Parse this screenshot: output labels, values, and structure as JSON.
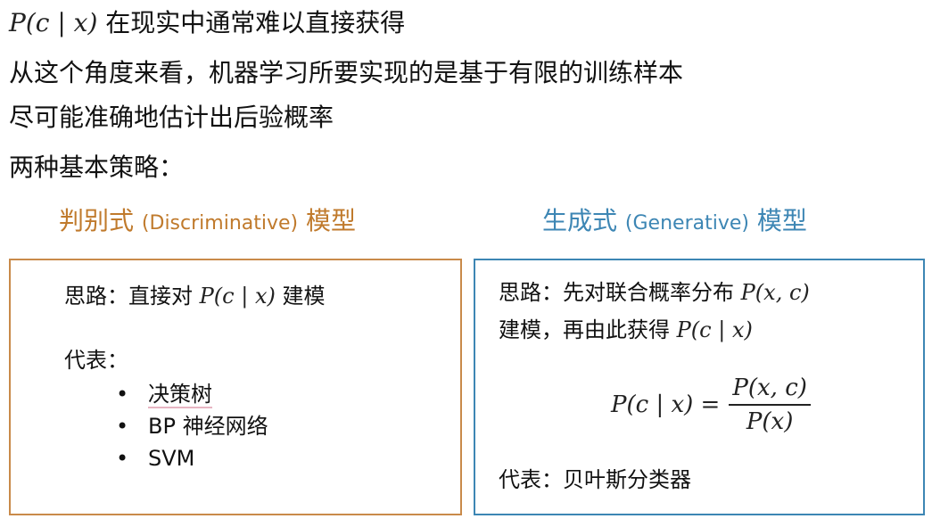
{
  "line1": {
    "math": "P(c | x)",
    "text": " 在现实中通常难以直接获得"
  },
  "line2": "从这个角度来看，机器学习所要实现的是基于有限的训练样本",
  "line3": "尽可能准确地估计出后验概率",
  "line4": "两种基本策略：",
  "left": {
    "heading_cn1": "判别式",
    "heading_en": "(Discriminative)",
    "heading_cn2": "模型",
    "idea_label": "思路：直接对",
    "idea_math": "P(c | x)",
    "idea_tail": "建模",
    "rep_label": "代表：",
    "examples": [
      "决策树",
      "BP 神经网络",
      "SVM"
    ]
  },
  "right": {
    "heading_cn1": "生成式",
    "heading_en": "(Generative)",
    "heading_cn2": "模型",
    "idea_line1": "思路：先对联合概率分布",
    "idea_math1": "P(x, c)",
    "idea_line2": "建模，再由此获得",
    "idea_math2": "P(c | x)",
    "formula_lhs": "P(c | x) =",
    "formula_num": "P(x, c)",
    "formula_den": "P(x)",
    "rep": "代表：贝叶斯分类器"
  },
  "colors": {
    "left_accent": "#c07a2c",
    "right_accent": "#3d86b4"
  }
}
